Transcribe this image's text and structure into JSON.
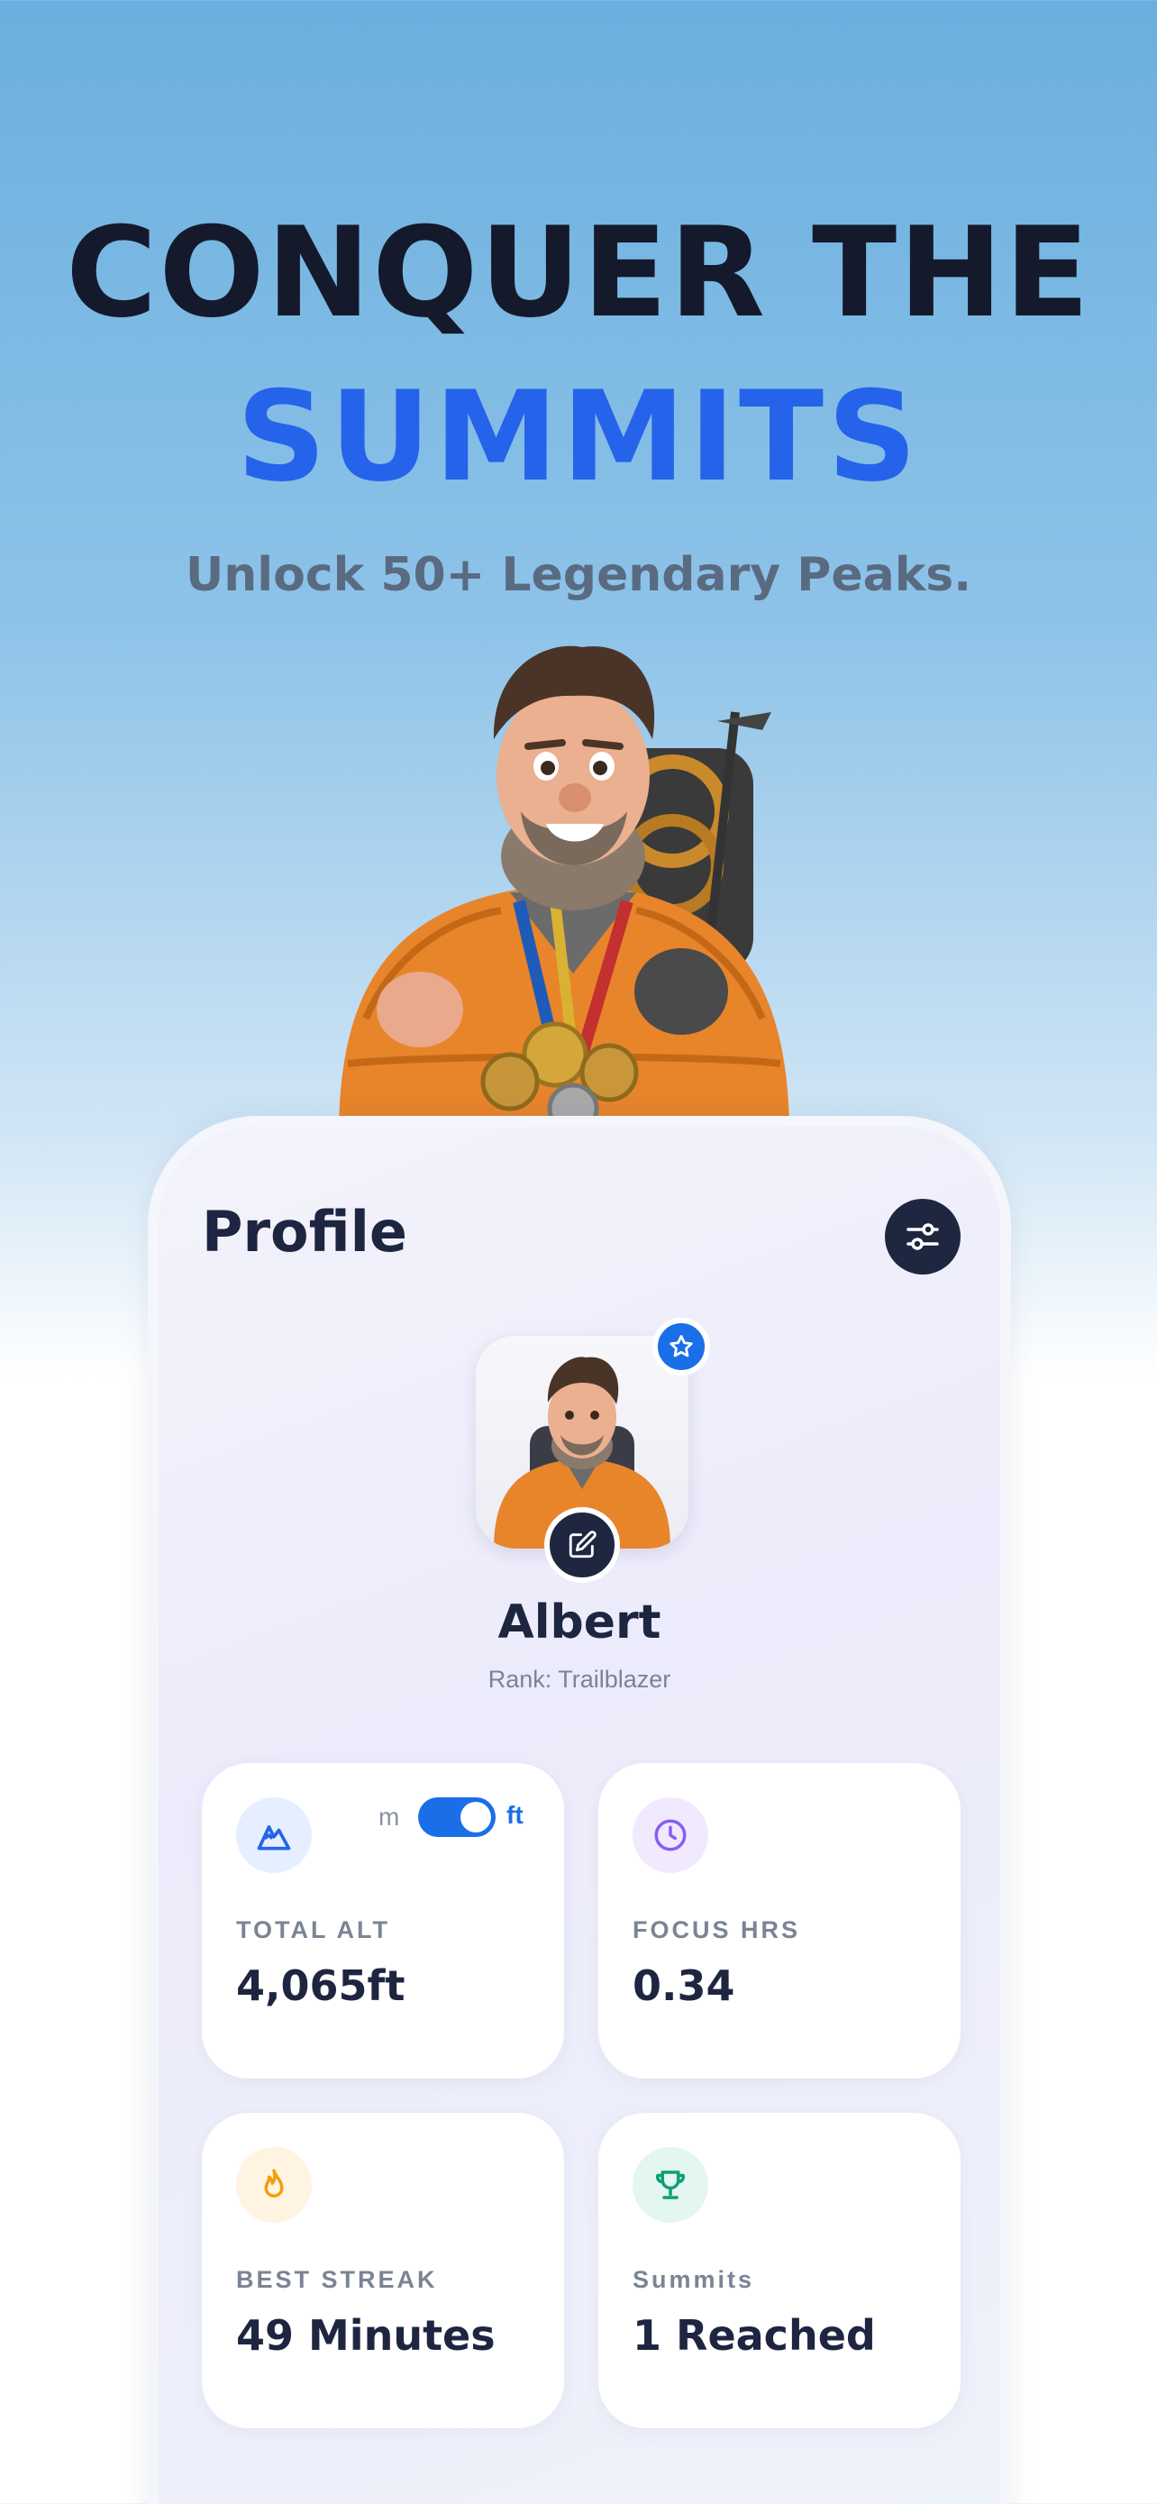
{
  "hero": {
    "headline_line1": "CONQUER THE",
    "headline_line2": "SUMMITS",
    "subtitle": "Unlock 50+ Legendary Peaks."
  },
  "profile": {
    "title": "Profile",
    "user_name": "Albert",
    "rank": "Rank: Trailblazer"
  },
  "stats": {
    "total_alt": {
      "label": "TOTAL ALT",
      "value": "4,065ft",
      "unit_left": "m",
      "unit_right": "ft",
      "unit_selected": "ft"
    },
    "focus_hrs": {
      "label": "FOCUS HRS",
      "value": "0.34"
    },
    "best_streak": {
      "label": "BEST STREAK",
      "value": "49 Minutes"
    },
    "summits": {
      "label": "Summits",
      "value": "1 Reached"
    }
  },
  "colors": {
    "accent_blue": "#2563eb",
    "toggle_blue": "#1a6fe8",
    "dark": "#1e2540",
    "mountain_icon_bg": "#e6efff",
    "clock_icon_bg": "#f1eaff",
    "flame_icon_bg": "#fff3e2",
    "trophy_icon_bg": "#e3f6ef"
  },
  "icons": {
    "settings": "sliders-icon",
    "badge": "star-icon",
    "edit": "edit-icon",
    "total_alt": "mountain-icon",
    "focus_hrs": "clock-icon",
    "best_streak": "flame-icon",
    "summits": "trophy-icon"
  }
}
